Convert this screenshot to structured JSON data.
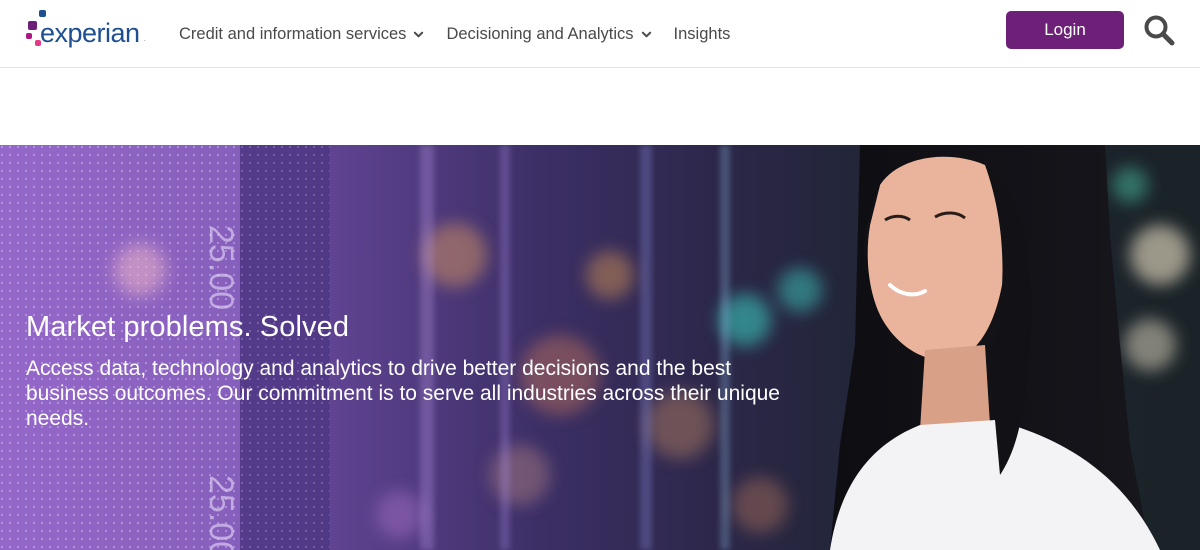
{
  "brand": {
    "name": "experian",
    "trademark": ".",
    "colors": {
      "wordmark": "#1d4f91",
      "dot_blue": "#1d4f91",
      "dot_purple": "#6d2077",
      "dot_magenta": "#e63888",
      "dot_pink": "#af1685"
    }
  },
  "nav": {
    "items": [
      {
        "label": "Credit and information services",
        "has_dropdown": true,
        "icon": "chevron-down-icon"
      },
      {
        "label": "Decisioning and Analytics",
        "has_dropdown": true,
        "icon": "chevron-down-icon"
      },
      {
        "label": "Insights",
        "has_dropdown": false
      }
    ]
  },
  "header": {
    "login_label": "Login",
    "login_color": "#6d2077",
    "search_icon": "search-icon"
  },
  "hero": {
    "title": "Market problems. Solved",
    "description": "Access data, technology and analytics to drive better decisions and the best business outcomes. Our commitment is to serve all industries across their unique needs.",
    "image": "woman-smiling-in-front-of-digital-stock-display",
    "display_numbers": [
      "25.00",
      "25.00"
    ]
  }
}
